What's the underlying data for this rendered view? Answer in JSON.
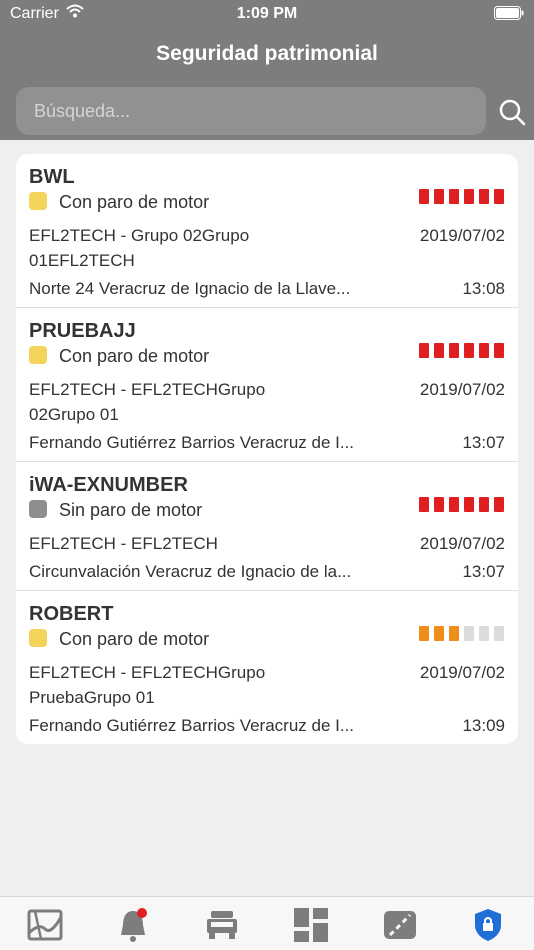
{
  "status_bar": {
    "carrier": "Carrier",
    "time": "1:09 PM"
  },
  "nav": {
    "title": "Seguridad patrimonial"
  },
  "search": {
    "placeholder": "Búsqueda..."
  },
  "colors": {
    "header": "#7d7d7d",
    "yellow": "#f3d35a",
    "gray": "#8e8e8e",
    "red": "#e02020",
    "orange": "#ef8f1a",
    "light": "#dcdcdc",
    "active_tab": "#1f6fd6"
  },
  "vehicles": [
    {
      "name": "BWL",
      "status": "Con paro de motor",
      "status_color": "yellow",
      "signal_level": 6,
      "group": "EFL2TECH - Grupo 02Grupo 01EFL2TECH",
      "date": "2019/07/02",
      "address": "Norte 24 Veracruz de Ignacio de la Llave...",
      "time": "13:08"
    },
    {
      "name": "PRUEBAJJ",
      "status": "Con paro de motor",
      "status_color": "yellow",
      "signal_level": 6,
      "group": "EFL2TECH - EFL2TECHGrupo 02Grupo 01",
      "date": "2019/07/02",
      "address": "Fernando Gutiérrez Barrios Veracruz de I...",
      "time": "13:07"
    },
    {
      "name": "iWA-EXNUMBER",
      "status": "Sin paro de motor",
      "status_color": "gray",
      "signal_level": 6,
      "group": "EFL2TECH - EFL2TECH",
      "date": "2019/07/02",
      "address": "Circunvalación Veracruz de Ignacio de la...",
      "time": "13:07"
    },
    {
      "name": "ROBERT",
      "status": "Con paro de motor",
      "status_color": "yellow",
      "signal_level": 3,
      "group": "EFL2TECH - EFL2TECHGrupo PruebaGrupo 01",
      "date": "2019/07/02",
      "address": "Fernando Gutiérrez Barrios Veracruz de I...",
      "time": "13:09"
    }
  ],
  "tabs": [
    {
      "icon": "map-icon"
    },
    {
      "icon": "bell-icon",
      "badge": true
    },
    {
      "icon": "truck-icon"
    },
    {
      "icon": "dashboard-icon"
    },
    {
      "icon": "road-icon"
    },
    {
      "icon": "shield-lock-icon",
      "active": true
    }
  ]
}
